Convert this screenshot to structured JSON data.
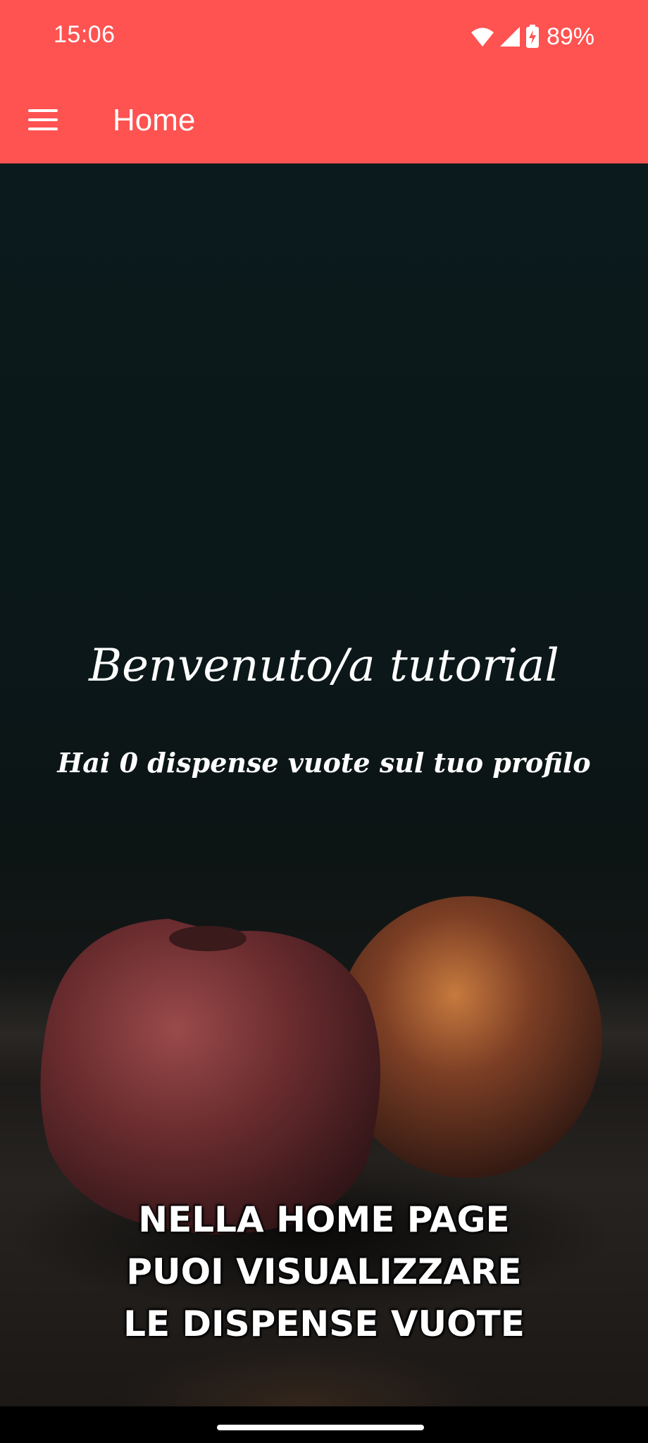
{
  "status_bar": {
    "time": "15:06",
    "battery_percent": "89%",
    "icons": [
      "wifi-icon",
      "signal-icon",
      "battery-charging-icon"
    ]
  },
  "app_bar": {
    "title": "Home",
    "menu_icon": "hamburger-menu-icon",
    "background_color": "#fe5351"
  },
  "main": {
    "welcome_text": "Benvenuto/a tutorial",
    "empty_pantries_text": "Hai 0 dispense vuote sul tuo profilo",
    "caption_lines": [
      "NELLA HOME PAGE",
      "PUOI VISUALIZZARE",
      "LE DISPENSE VUOTE"
    ],
    "background_image": "peaches-on-dark-background"
  }
}
